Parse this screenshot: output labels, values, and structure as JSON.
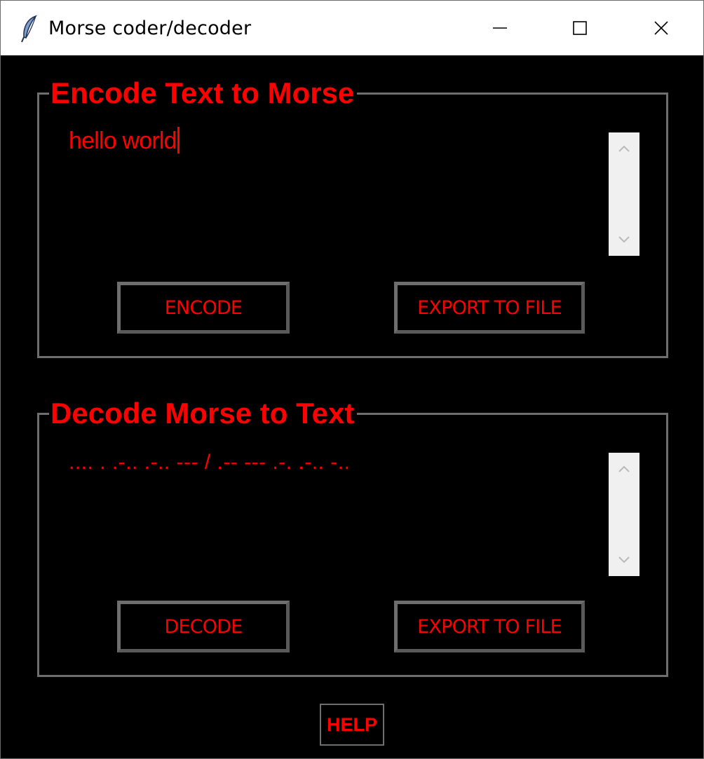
{
  "window": {
    "title": "Morse coder/decoder",
    "icon": "feather-icon",
    "controls": [
      "minimize-icon",
      "maximize-icon",
      "close-icon"
    ]
  },
  "colors": {
    "background": "#000000",
    "accent": "#ff0000",
    "border": "#6e6e6e",
    "scrollbar": "#f0f0f0"
  },
  "encode": {
    "title": "Encode Text to Morse",
    "input_value": "hello world",
    "encode_button": "ENCODE",
    "export_button": "EXPORT TO FILE"
  },
  "decode": {
    "title": "Decode Morse to Text",
    "input_value": ".... . .-.. .-.. --- / .-- --- .-. .-.. -..",
    "decode_button": "DECODE",
    "export_button": "EXPORT TO FILE"
  },
  "help_button": "HELP"
}
